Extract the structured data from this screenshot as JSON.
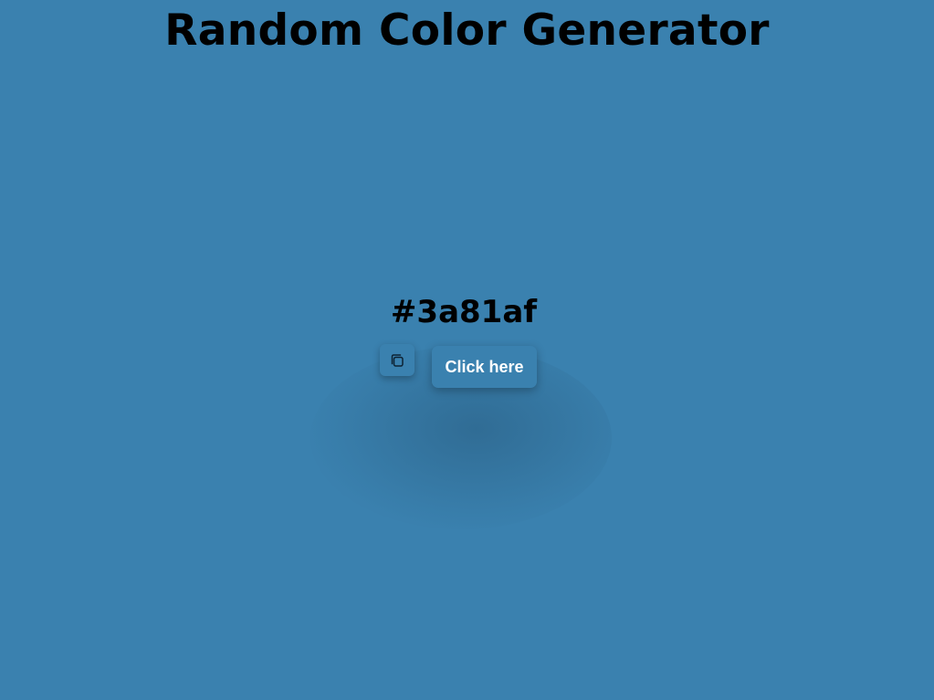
{
  "header": {
    "title": "Random Color Generator"
  },
  "color": {
    "hex_label": "#3a81af",
    "background": "#3a81af"
  },
  "actions": {
    "copy_icon": "copy-icon",
    "generate_label": "Click here"
  }
}
